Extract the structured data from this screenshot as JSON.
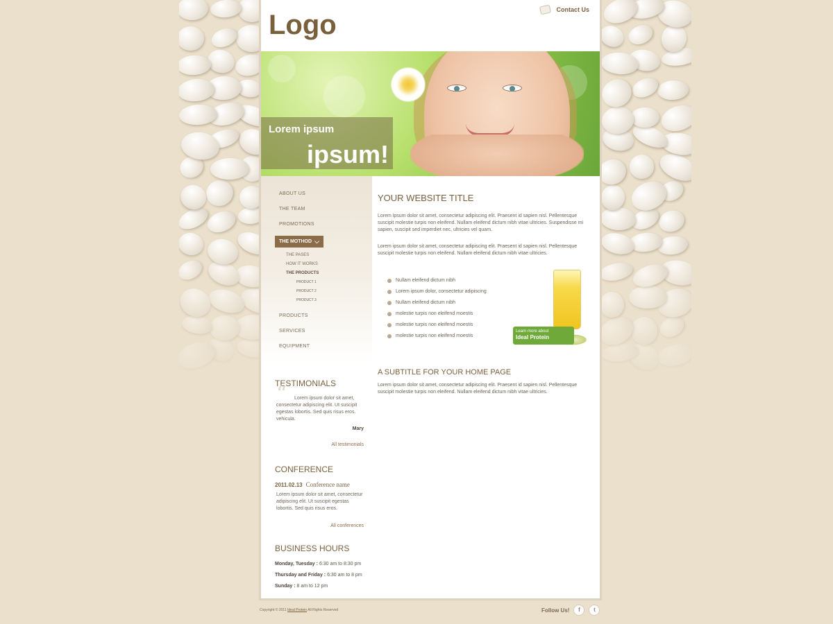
{
  "header": {
    "logo": "Logo",
    "contact_link": "Contact Us"
  },
  "banner": {
    "line1": "Lorem ipsum",
    "line2": "ipsum!"
  },
  "nav": {
    "items_top": [
      "ABOUT US",
      "THE TEAM",
      "PROMOTIONS"
    ],
    "active": "THE MOTHOD",
    "sub_items": [
      "THE PASES",
      "HOW IT WORKS",
      "THE PRODUCTS"
    ],
    "sub_sub_items": [
      "PRODUCT 1",
      "PRODUCT 2",
      "PRODUCT 3"
    ],
    "items_bottom": [
      "PRODUCTS",
      "SERVICES",
      "EQUIPMENT"
    ]
  },
  "testimonials": {
    "heading": "TESTIMONIALS",
    "text": "Lorem ipsum dolor sit amet, consectetur adipiscing elit. Ut suscipit egestas lobortis. Sed quis risus eros. vehicula.",
    "author": "Mary",
    "link": "All testimonials"
  },
  "conference": {
    "heading": "CONFERENCE",
    "date": "2011.02.13",
    "name": "Conference name",
    "text": "Lorem ipsum dolor sit amet, consectetur adipiscing elit. Ut suscipit egestas lobortis. Sed quis risus eros.",
    "link": "All conferences"
  },
  "hours": {
    "heading": "BUSINESS HOURS",
    "rows": [
      {
        "days": "Monday, Tuesday :",
        "time": "6:30 am to 8:30 pm"
      },
      {
        "days": "Thursday and Friday :",
        "time": "6:30 am to 8 pm"
      },
      {
        "days": "Sunday :",
        "time": "8 am to 12 pm"
      }
    ]
  },
  "main": {
    "title": "YOUR WEBSITE TITLE",
    "para1": "Lorem ipsum dolor sit amet, consectetur adipiscing elit. Praesent id sapien nisl. Pellentesque suscipit molestie turpis non eleifend. Nullam eleifend dictum nibh vitae ultricies. Suspendisse mi sapien, suscipit sed imperdiet nec, ultricies vel quam.",
    "para2": "Lorem ipsum dolor sit amet, consectetur adipiscing elit. Praesent id sapien nisl. Pellentesque suscipit molestie turpis non eleifend. Nullam eleifend dictum nibh vitae ultricies.",
    "bullets": [
      "Nullam eleifend dictum nibh",
      "Lorem ipsum dolor, consectetur adipiscing",
      "Nullam eleifend dictum nibh",
      "molestie turpis non eleifend moestis",
      "molestie turpis non eleifend moestis",
      "molestie turpis non eleifend moestis"
    ],
    "promo_line1": "Learn more about",
    "promo_line2": "Ideal Protein",
    "subtitle": "A SUBTITLE FOR YOUR HOME PAGE",
    "para3": "Lorem ipsum dolor sit amet, consectetur adipiscing elit. Praesent id sapien nisl. Pellentesque suscipit molestie turpis non eleifend. Nullam eleifend dictum nibh vitae ultricies."
  },
  "footer": {
    "copy_prefix": "Copyright © 2011",
    "copy_link": "Ideal Protein",
    "copy_suffix": "All Rights Reserved",
    "follow": "Follow Us!",
    "facebook": "f",
    "twitter": "t"
  },
  "colors": {
    "background": "#ebe0cc",
    "accent": "#7a5f3d",
    "nav_active": "#8c6b48",
    "promo_green": "#6fa93a"
  }
}
